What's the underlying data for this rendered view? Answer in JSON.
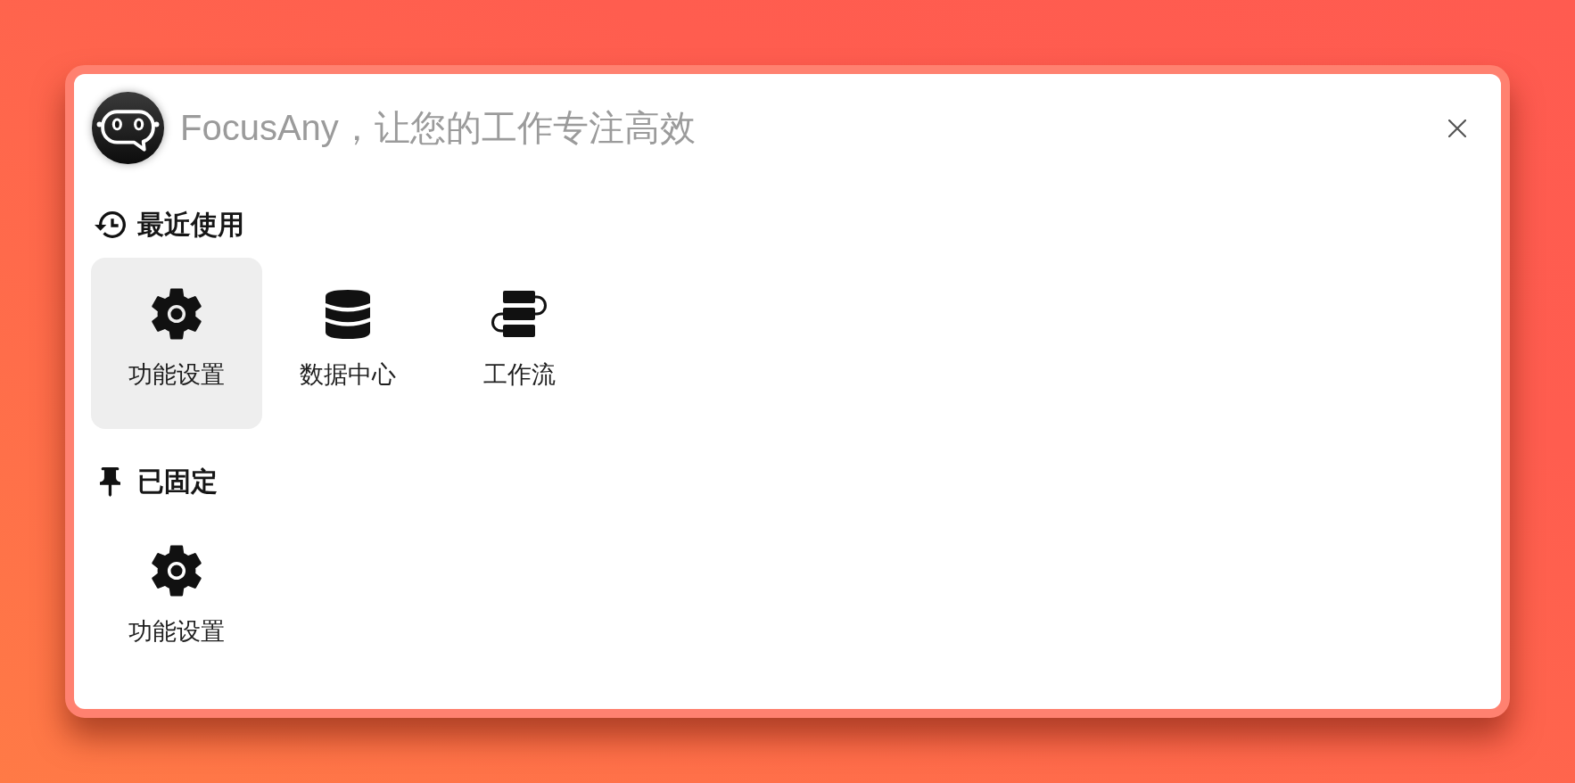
{
  "search": {
    "placeholder": "FocusAny，让您的工作专注高效"
  },
  "sections": [
    {
      "title": "最近使用",
      "kind": "recent",
      "items": [
        {
          "label": "功能设置",
          "kind": "settings",
          "selected": true
        },
        {
          "label": "数据中心",
          "kind": "database",
          "selected": false
        },
        {
          "label": "工作流",
          "kind": "workflow",
          "selected": false
        }
      ]
    },
    {
      "title": "已固定",
      "kind": "pinned",
      "items": [
        {
          "label": "功能设置",
          "kind": "settings",
          "selected": false
        }
      ]
    }
  ]
}
